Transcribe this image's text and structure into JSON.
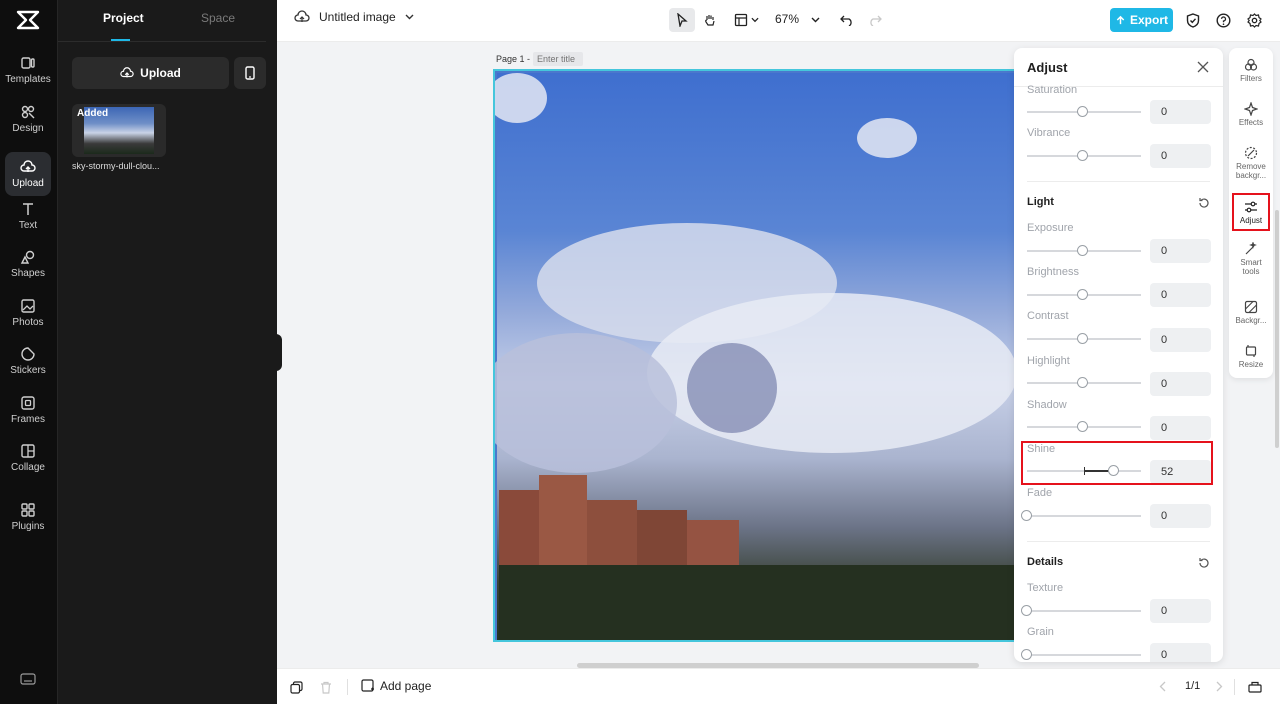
{
  "rail": {
    "items": [
      {
        "label": "Templates",
        "icon": "templates-icon"
      },
      {
        "label": "Design",
        "icon": "design-icon"
      },
      {
        "label": "Upload",
        "icon": "cloud-upload-icon"
      },
      {
        "label": "Text",
        "icon": "text-icon"
      },
      {
        "label": "Shapes",
        "icon": "shapes-icon"
      },
      {
        "label": "Photos",
        "icon": "photos-icon"
      },
      {
        "label": "Stickers",
        "icon": "stickers-icon"
      },
      {
        "label": "Frames",
        "icon": "frames-icon"
      },
      {
        "label": "Collage",
        "icon": "collage-icon"
      },
      {
        "label": "Plugins",
        "icon": "plugins-icon"
      }
    ],
    "active": "Upload"
  },
  "panel": {
    "tabs": [
      "Project",
      "Space"
    ],
    "upload_label": "Upload",
    "asset": {
      "badge": "Added",
      "name": "sky-stormy-dull-clou..."
    }
  },
  "topbar": {
    "title": "Untitled image",
    "zoom": "67%",
    "export_label": "Export"
  },
  "canvas": {
    "page_label": "Page 1 -",
    "title_placeholder": "Enter title"
  },
  "adjust": {
    "title": "Adjust",
    "color_rows": [
      {
        "label": "Saturation",
        "value": "0"
      },
      {
        "label": "Vibrance",
        "value": "0"
      }
    ],
    "light": {
      "title": "Light",
      "rows": [
        {
          "label": "Exposure",
          "value": "0"
        },
        {
          "label": "Brightness",
          "value": "0"
        },
        {
          "label": "Contrast",
          "value": "0"
        },
        {
          "label": "Highlight",
          "value": "0"
        },
        {
          "label": "Shadow",
          "value": "0"
        },
        {
          "label": "Shine",
          "value": "52"
        },
        {
          "label": "Fade",
          "value": "0"
        }
      ]
    },
    "details": {
      "title": "Details",
      "rows": [
        {
          "label": "Texture",
          "value": "0"
        },
        {
          "label": "Grain",
          "value": "0"
        }
      ]
    }
  },
  "right_rail": {
    "items": [
      {
        "label": "Filters",
        "icon": "filters-icon"
      },
      {
        "label": "Effects",
        "icon": "effects-icon"
      },
      {
        "label": "Remove backgr...",
        "icon": "remove-background-icon"
      },
      {
        "label": "Adjust",
        "icon": "adjust-sliders-icon"
      },
      {
        "label": "Smart tools",
        "icon": "smart-tools-icon"
      },
      {
        "label": "Backgr...",
        "icon": "background-icon"
      },
      {
        "label": "Resize",
        "icon": "resize-icon"
      }
    ],
    "active": "Adjust"
  },
  "bottombar": {
    "add_page_label": "Add page",
    "page_indicator": "1/1"
  },
  "colors": {
    "accent": "#1fb8e6",
    "highlight": "#e5121c",
    "rail_bg": "#0e0e0e",
    "panel_bg": "#1a1a1a"
  }
}
